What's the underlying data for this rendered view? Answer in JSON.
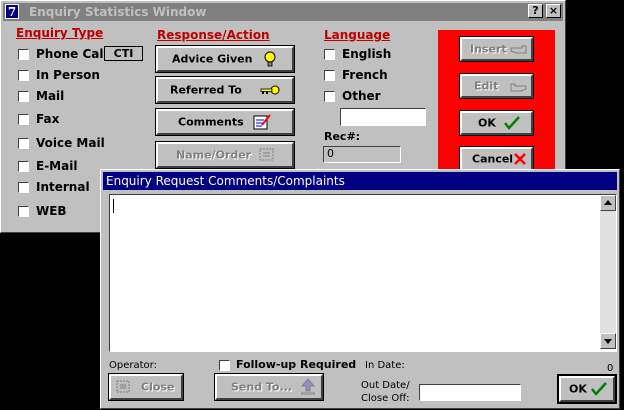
{
  "colors": {
    "accent_red": "#ff0000",
    "section_red": "#c00000",
    "title_active": "#000080"
  },
  "stats_window": {
    "sys_icon": "7",
    "title": "Enquiry Statistics Window",
    "help_btn": "?",
    "close_btn": "×",
    "enquiry_type": {
      "heading": "Enquiry Type",
      "items": [
        "Phone Call",
        "In Person",
        "Mail",
        "Fax",
        "Voice Mail",
        "E-Mail",
        "Internal",
        "WEB"
      ],
      "cti_label": "CTI"
    },
    "response": {
      "heading": "Response/Action",
      "buttons": [
        {
          "label": "Advice Given",
          "icon": "lightbulb-icon"
        },
        {
          "label": "Referred To",
          "icon": "key-icon"
        },
        {
          "label": "Comments",
          "icon": "notepad-icon"
        },
        {
          "label": "Name/Order",
          "icon": "list-icon",
          "disabled": true
        }
      ]
    },
    "language": {
      "heading": "Language",
      "items": [
        "English",
        "French",
        "Other"
      ],
      "other_value": "",
      "rec_label": "Rec#:",
      "rec_value": "0"
    },
    "actions": {
      "insert": "Insert",
      "edit": "Edit",
      "ok": "OK",
      "cancel": "Cancel"
    }
  },
  "comments_window": {
    "title": "Enquiry Request Comments/Complaints",
    "text_value": "",
    "operator_label": "Operator:",
    "follow_up_label": "Follow-up Required",
    "in_date_label": "In Date:",
    "counter": "0",
    "close_btn": "Close",
    "send_to_btn": "Send To...",
    "out_date_label_1": "Out Date/",
    "out_date_label_2": "Close Off:",
    "out_date_value": "",
    "ok_btn": "OK"
  }
}
